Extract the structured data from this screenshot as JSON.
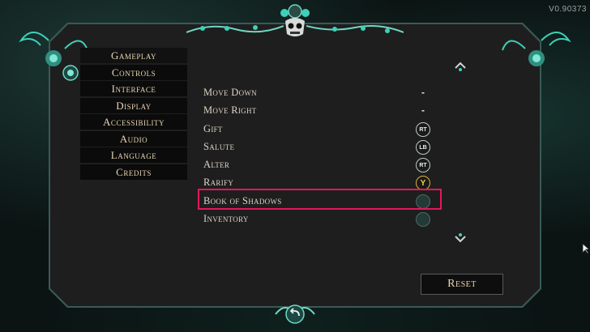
{
  "version": "V0.90373",
  "nav": {
    "items": [
      {
        "label": "Gameplay"
      },
      {
        "label": "Controls"
      },
      {
        "label": "Interface"
      },
      {
        "label": "Display"
      },
      {
        "label": "Accessibility"
      },
      {
        "label": "Audio"
      },
      {
        "label": "Language"
      },
      {
        "label": "Credits"
      }
    ]
  },
  "bindings": [
    {
      "action": "Move Down",
      "value": "-"
    },
    {
      "action": "Move Right",
      "value": "-"
    },
    {
      "action": "Gift",
      "button": "RT"
    },
    {
      "action": "Salute",
      "button": "LB"
    },
    {
      "action": "Alter",
      "button": "RT"
    },
    {
      "action": "Rarify",
      "button": "Y"
    },
    {
      "action": "Book of Shadows",
      "button": ""
    },
    {
      "action": "Inventory",
      "button": ""
    }
  ],
  "reset_label": "Reset",
  "colors": {
    "highlight": "#e3175b",
    "text": "#ddd3c4",
    "nav_text": "#e9d6b3",
    "accent": "#3fd0b8"
  }
}
